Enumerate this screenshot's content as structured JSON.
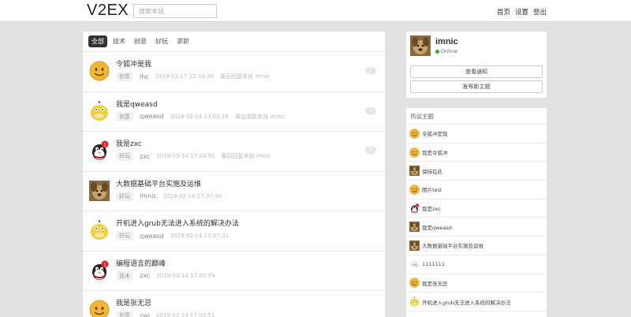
{
  "header": {
    "logo": "V2EX",
    "search_placeholder": "搜索本站",
    "nav": [
      "首页",
      "设置",
      "登出"
    ]
  },
  "tabs": [
    "全部",
    "技术",
    "创意",
    "好玩",
    "求职"
  ],
  "topics": [
    {
      "title": "令狐冲是我",
      "node": "创意",
      "author": "lhc",
      "time": "2019-02-17 22:19:26",
      "last_reply": "最后回复来自 imnic",
      "count": "7",
      "avatar": "smiley"
    },
    {
      "title": "我是qweasd",
      "node": "创意",
      "author": "qweasd",
      "time": "2019-02-14 17:03:16",
      "last_reply": "最后回复来自 imnic",
      "count": "1",
      "avatar": "psyduck"
    },
    {
      "title": "我是zxc",
      "node": "好玩",
      "author": "zxc",
      "time": "2019-02-14 17:04:50",
      "last_reply": "最后回复来自 imnic",
      "count": "3",
      "avatar": "qq"
    },
    {
      "title": "大数据基础平台实施及运维",
      "node": "好玩",
      "author": "imnic",
      "time": "2019-02-14 17:07:40",
      "last_reply": "",
      "count": "",
      "avatar": "dog"
    },
    {
      "title": "开机进入grub无法进入系统的解决办法",
      "node": "好玩",
      "author": "qweasd",
      "time": "2019-02-14 17:07:01",
      "last_reply": "",
      "count": "",
      "avatar": "psyduck"
    },
    {
      "title": "编程语言的巅峰",
      "node": "技术",
      "author": "zxc",
      "time": "2019-02-14 17:05:59",
      "last_reply": "",
      "count": "",
      "avatar": "qq"
    },
    {
      "title": "我是张无忌",
      "node": "创意",
      "author": "zwj",
      "time": "2019-02-14 17:03:51",
      "last_reply": "",
      "count": "",
      "avatar": "smiley"
    }
  ],
  "profile": {
    "username": "imnic",
    "status": "Online",
    "btn_notify": "查看通知",
    "btn_new": "发布新主题"
  },
  "hot": {
    "title": "热议主题",
    "items": [
      {
        "title": "令狐冲是我",
        "avatar": "smiley"
      },
      {
        "title": "我是令狐冲",
        "avatar": "smiley"
      },
      {
        "title": "保持在此",
        "avatar": "dog"
      },
      {
        "title": "图片test",
        "avatar": "smiley"
      },
      {
        "title": "我是zxc",
        "avatar": "qq"
      },
      {
        "title": "我是qweasd",
        "avatar": "dog"
      },
      {
        "title": "大数据基础平台实施及运维",
        "avatar": "dog"
      },
      {
        "title": "1111111",
        "avatar": "cloud"
      },
      {
        "title": "我是张无忌",
        "avatar": "smiley"
      },
      {
        "title": "开机进入grub无法进入系统的解决办法",
        "avatar": "psyduck"
      }
    ]
  }
}
